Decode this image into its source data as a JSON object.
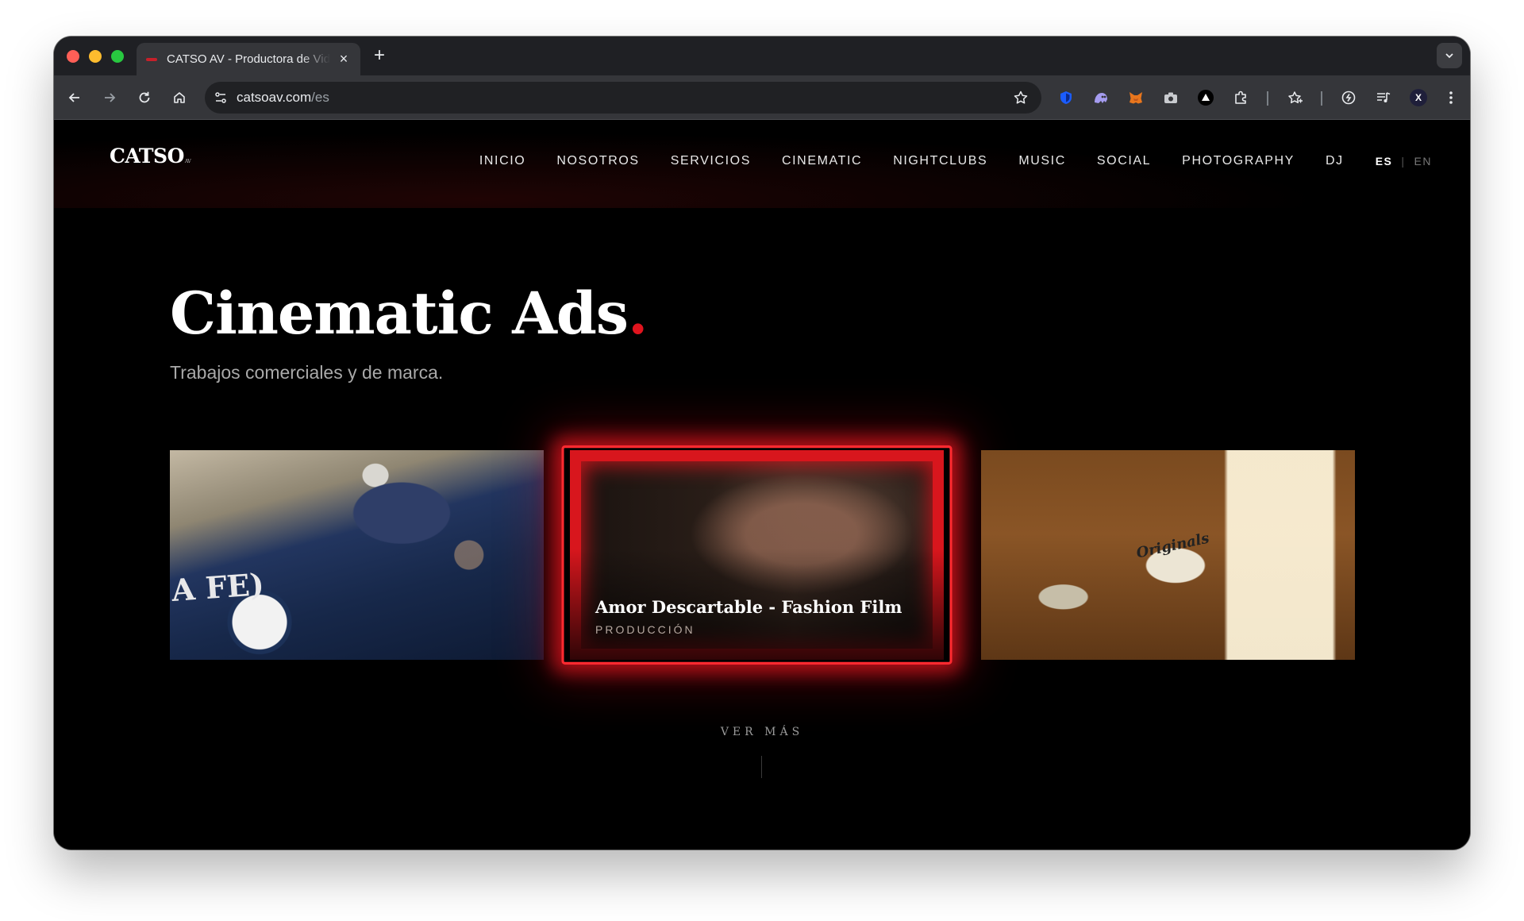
{
  "browser": {
    "tab": {
      "title": "CATSO AV - Productora de Video"
    },
    "omnibox": {
      "domain": "catsoav.com",
      "path": "/es"
    },
    "icons": {
      "close_tab": "×",
      "new_tab": "+"
    },
    "extensions": [
      "bitwarden-shield-icon",
      "ghost-icon",
      "metamask-fox-icon",
      "camera-icon",
      "proton-triangle-icon",
      "puzzle-icon",
      "bookmarks-star-icon",
      "refresh-circle-icon",
      "media-queue-icon",
      "profile-avatar-icon"
    ],
    "profile_initial": "X"
  },
  "site": {
    "logo": "CATSO",
    "logo_suffix": "AV",
    "nav": [
      "INICIO",
      "NOSOTROS",
      "SERVICIOS",
      "CINEMATIC",
      "NIGHTCLUBS",
      "MUSIC",
      "SOCIAL",
      "PHOTOGRAPHY",
      "DJ"
    ],
    "lang": {
      "active": "ES",
      "separator": "|",
      "inactive": "EN"
    },
    "hero": {
      "title": "Cinematic Ads",
      "title_dot": ".",
      "subtitle": "Trabajos comerciales y de marca."
    },
    "cards": [
      {
        "image_text": "A FE)"
      },
      {
        "title": "Amor Descartable - Fashion Film",
        "tag": "PRODUCCIÓN"
      },
      {
        "image_text": "Originals"
      }
    ],
    "see_more": "VER MÁS"
  },
  "colors": {
    "accent_red": "#e0141e",
    "page_bg": "#000000",
    "chrome_toolbar": "#35363a"
  }
}
